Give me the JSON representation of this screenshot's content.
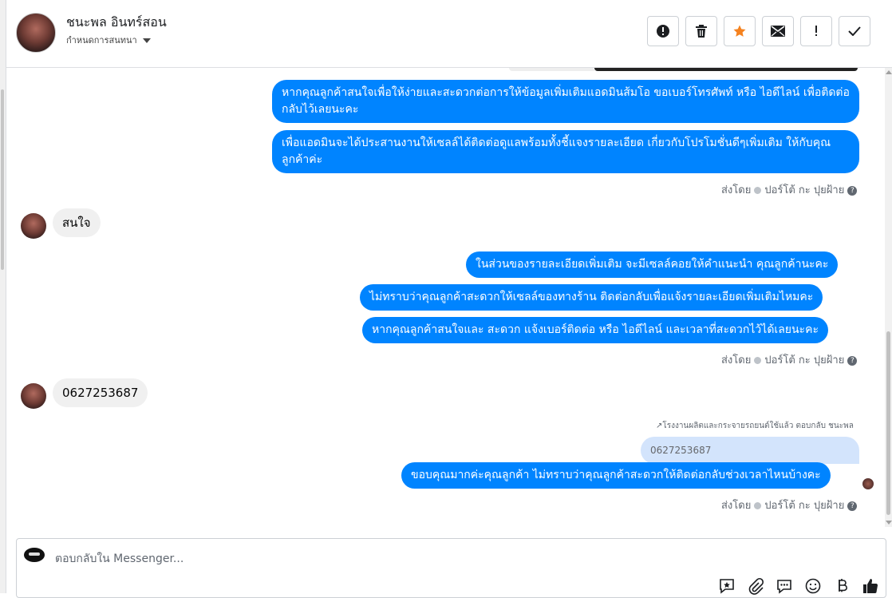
{
  "header": {
    "name": "ชนะพล อินทร์สอน",
    "sub": "กำหนดการสนทนา",
    "actions": [
      {
        "icon": "alert-circle-icon"
      },
      {
        "icon": "trash-icon"
      },
      {
        "icon": "star-icon"
      },
      {
        "icon": "envelope-icon"
      },
      {
        "icon": "exclamation-icon"
      },
      {
        "icon": "check-icon"
      }
    ]
  },
  "messages": {
    "out1": "หากคุณลูกค้าสนใจเพื่อให้ง่ายและสะดวกต่อการให้ข้อมูลเพิ่มเติมแอดมินส้มโอ ขอเบอร์โทรศัพท์ หรือ ไอดีไลน์ เพื่อติดต่อกลับไว้เลยนะคะ",
    "out2": "เพื่อแอดมินจะได้ประสานงานให้เซลล์ได้ติดต่อดูแลพร้อมทั้งชี้แจงรายละเอียด เกี่ยวกับโปรโมชั่นดีๆเพิ่มเติม ให้กับคุณลูกค้าค่ะ",
    "sent1_prefix": "ส่งโดย",
    "sent1_name": "ปอร์โต้ กะ ปุยฝ้าย",
    "in1": "สนใจ",
    "out3": "ในส่วนของรายละเอียดเพิ่มเติม จะมีเซลล์คอยให้คำแนะนำ คุณลูกค้านะคะ",
    "out4": "ไม่ทราบว่าคุณลูกค้าสะดวกให้เซลล์ของทางร้าน ติดต่อกลับเพื่อแจ้งรายละเอียดเพิ่มเติมไหมคะ",
    "out5": "หากคุณลูกค้าสนใจและ สะดวก แจ้งเบอร์ติดต่อ หรือ ไอดีไลน์ และเวลาที่สะดวกไว้ได้เลยนะคะ",
    "sent2_prefix": "ส่งโดย",
    "sent2_name": "ปอร์โต้ กะ ปุยฝ้าย",
    "in2": "0627253687",
    "reply_line": "โรงงานผลิตและกระจายรถยนต์ใช้แล้ว ตอบกลับ ชนะพล",
    "quoted": "0627253687",
    "out6": "ขอบคุณมากค่ะคุณลูกค้า ไม่ทราบว่าคุณลูกค้าสะดวกให้ติดต่อกลับช่วงเวลาไหนบ้างคะ",
    "sent3_prefix": "ส่งโดย",
    "sent3_name": "ปอร์โต้ กะ ปุยฝ้าย"
  },
  "composer": {
    "placeholder": "ตอบกลับใน Messenger..."
  },
  "colors": {
    "outgoing": "#0084ff",
    "incoming": "#f0f0f0",
    "star": "#f5821f"
  }
}
